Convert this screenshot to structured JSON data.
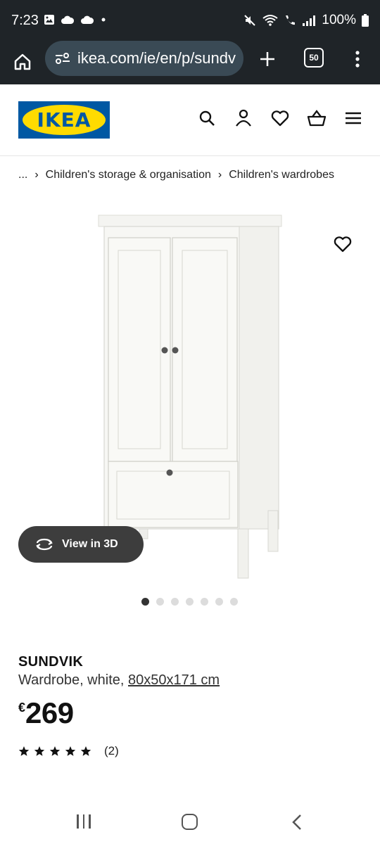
{
  "status_bar": {
    "time": "7:23",
    "battery": "100%"
  },
  "browser": {
    "url": "ikea.com/ie/en/p/sundv",
    "tab_count": "50"
  },
  "header": {
    "logo_text": "IKEA",
    "icons": [
      "search-icon",
      "account-icon",
      "wishlist-heart-icon",
      "basket-icon",
      "hamburger-menu-icon"
    ]
  },
  "breadcrumb": {
    "ellipsis": "...",
    "separator": "›",
    "items": [
      "Children's storage & organisation",
      "Children's wardrobes"
    ]
  },
  "product": {
    "view3d_label": "View in 3D",
    "name": "SUNDVIK",
    "description": "Wardrobe, white,",
    "dimensions": "80x50x171 cm",
    "currency": "€",
    "price": "269",
    "rating": 5,
    "review_count": "(2)",
    "image_count": 7,
    "active_image": 1
  },
  "colors": {
    "ikea_blue": "#0058a3",
    "ikea_yellow": "#ffdb00",
    "browser_bg": "#1f2428",
    "url_pill": "#3a4a55"
  }
}
